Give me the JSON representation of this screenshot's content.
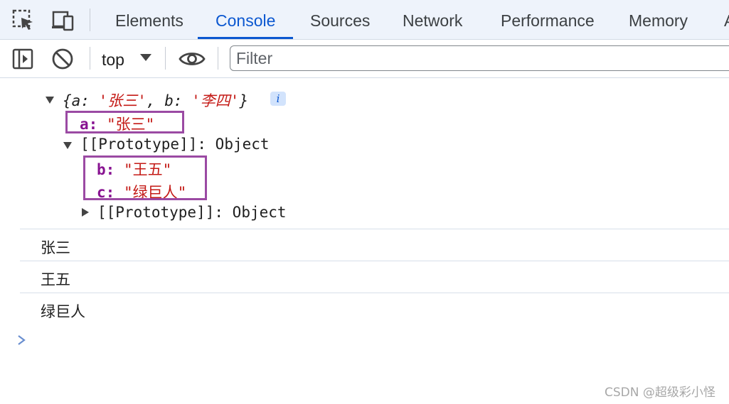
{
  "tabs": [
    {
      "label": "Elements",
      "active": false
    },
    {
      "label": "Console",
      "active": true
    },
    {
      "label": "Sources",
      "active": false
    },
    {
      "label": "Network",
      "active": false
    },
    {
      "label": "Performance",
      "active": false
    },
    {
      "label": "Memory",
      "active": false
    },
    {
      "label": "A",
      "active": false
    }
  ],
  "toolbar": {
    "context": "top",
    "filter_placeholder": "Filter"
  },
  "console": {
    "object_preview": {
      "open": "{",
      "a_key": "a",
      "a_val": "'张三'",
      "b_key": "b",
      "b_val": "'李四'",
      "close": "}",
      "info": "i"
    },
    "prop_a": {
      "key": "a",
      "value": "\"张三\""
    },
    "prototype_label": "[[Prototype]]",
    "prototype_type": "Object",
    "prop_b": {
      "key": "b",
      "value": "\"王五\""
    },
    "prop_c": {
      "key": "c",
      "value": "\"绿巨人\""
    },
    "inner_prototype_label": "[[Prototype]]",
    "inner_prototype_type": "Object",
    "logs": [
      "张三",
      "王五",
      "绿巨人"
    ]
  },
  "watermark": "CSDN @超级彩小怪",
  "colors": {
    "accent": "#0b57d0",
    "highlight_box": "#9b4aa3",
    "key": "#881391",
    "string": "#c41a16"
  }
}
